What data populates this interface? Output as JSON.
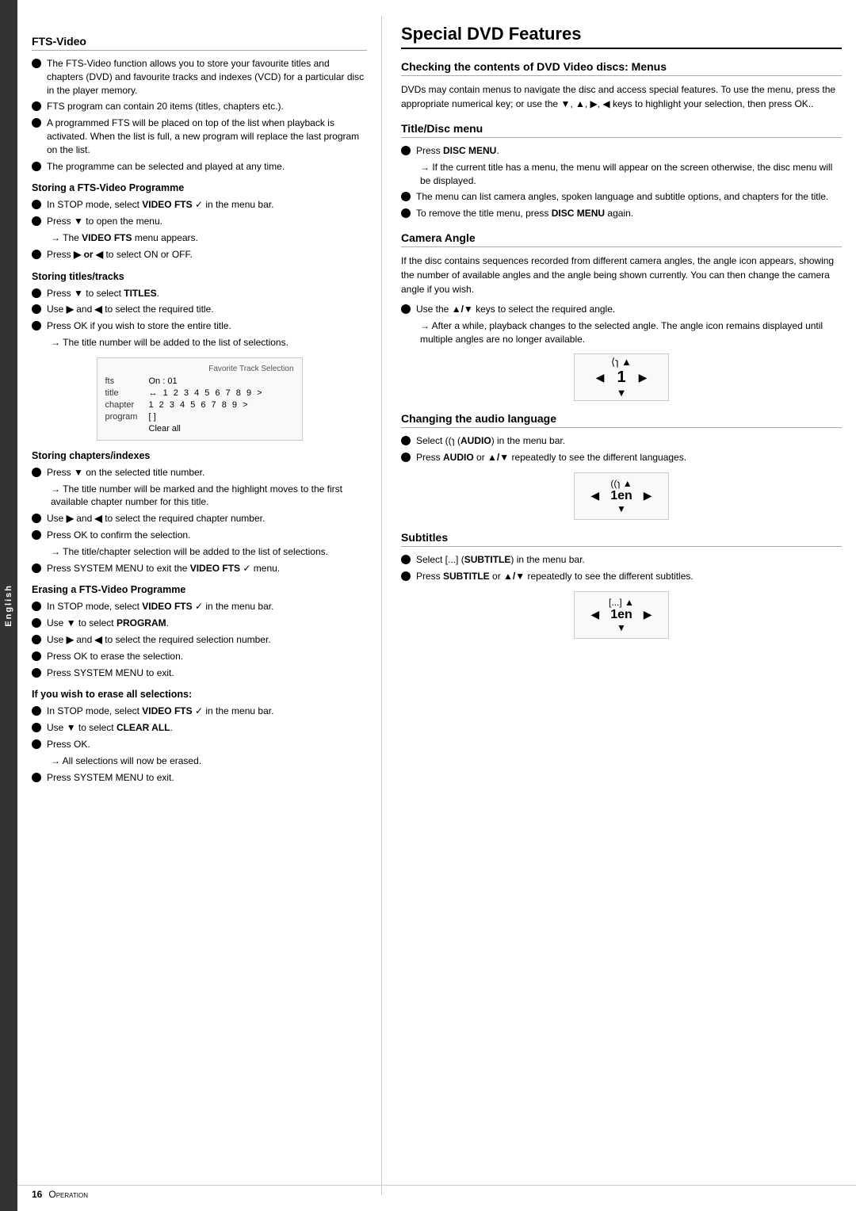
{
  "sidebar": {
    "label": "English"
  },
  "left": {
    "section_title": "FTS-Video",
    "intro_bullets": [
      "The FTS-Video function allows you to store your favourite titles and chapters (DVD) and favourite tracks and indexes (VCD) for a particular disc in the player memory.",
      "FTS program can contain 20 items (titles, chapters etc.).",
      "A programmed FTS will be placed on top of the list when playback is activated. When the list is full, a new program will replace the last program on the list.",
      "The programme can be selected and played at any time."
    ],
    "storing_programme": {
      "title": "Storing a FTS-Video Programme",
      "bullets": [
        {
          "text": "In STOP mode, select ",
          "bold": "VIDEO FTS",
          "after": " in the menu bar.",
          "icon": true
        },
        {
          "text": "Press ",
          "bold": "▼",
          "after": " to open the menu."
        },
        {
          "text": "→ The ",
          "bold": "VIDEO FTS",
          "after": " menu appears.",
          "arrow": true
        },
        {
          "text": "Press ",
          "bold": "▶ or ◀",
          "after": " to select ON or OFF."
        }
      ]
    },
    "storing_titles": {
      "title": "Storing titles/tracks",
      "bullets": [
        {
          "text": "Press ",
          "bold": "▼",
          "after": " to select ",
          "bold2": "TITLES",
          "end": "."
        },
        {
          "text": "Use ",
          "bold": "▶",
          "after": " and ",
          "bold2": "◀",
          "end": " to select the required title."
        },
        {
          "text": "Press OK if you wish to store the entire title."
        },
        {
          "text": "→ The title number will be added to the list of selections.",
          "arrow": true
        }
      ]
    },
    "fts_image": {
      "caption": "Favorite Track Selection",
      "fts_label": "fts",
      "on_value": "On : 01",
      "title_label": "title",
      "title_numbers": "1 2 3 4 5 6 7 8 9 >",
      "chapter_label": "chapter",
      "chapter_numbers": "1 2 3 4 5 6 7 8 9 >",
      "program_label": "program",
      "program_bracket": "[ ]",
      "clear_all": "Clear all"
    },
    "storing_chapters": {
      "title": "Storing chapters/indexes",
      "bullets": [
        {
          "text": "Press ",
          "bold": "▼",
          "after": " on the selected title number."
        },
        {
          "text": "→ The title number will be marked and the highlight moves to the first available chapter number for this title.",
          "arrow": true
        },
        {
          "text": "Use ",
          "bold": "▶",
          "after": " and ",
          "bold2": "◀",
          "end": " to select the required chapter number."
        },
        {
          "text": "Press OK to confirm the selection."
        },
        {
          "text": "→ The title/chapter selection will be added to the list of selections.",
          "arrow": true
        },
        {
          "text": "Press SYSTEM MENU to exit the ",
          "bold": "VIDEO FTS",
          "after": " menu.",
          "icon": true
        }
      ]
    },
    "erasing_programme": {
      "title": "Erasing a FTS-Video Programme",
      "bullets": [
        {
          "text": "In STOP mode, select ",
          "bold": "VIDEO FTS",
          "after": " in the menu bar.",
          "icon": true
        },
        {
          "text": "Use ",
          "bold": "▼",
          "after": " to select ",
          "bold2": "PROGRAM",
          "end": "."
        },
        {
          "text": "Use ",
          "bold": "▶",
          "after": " and ",
          "bold2": "◀",
          "end": " to select the required selection number."
        },
        {
          "text": "Press OK to erase the selection."
        },
        {
          "text": "Press SYSTEM MENU to exit."
        }
      ]
    },
    "erase_all": {
      "title": "If you wish to erase all selections:",
      "bullets": [
        {
          "text": "In STOP mode, select ",
          "bold": "VIDEO FTS",
          "after": " in the menu bar.",
          "icon": true
        },
        {
          "text": "Use ",
          "bold": "▼",
          "after": " to select ",
          "bold2": "CLEAR ALL",
          "end": "."
        },
        {
          "text": "Press OK."
        },
        {
          "text": "→ All selections will now be erased.",
          "arrow": true
        },
        {
          "text": "Press SYSTEM MENU to exit."
        }
      ]
    }
  },
  "right": {
    "main_title": "Special DVD Features",
    "checking_dvd": {
      "title": "Checking the contents of DVD Video discs: Menus",
      "body": "DVDs may contain menus to navigate the disc and access special features. To use the menu, press the appropriate numerical key; or use the ▼, ▲, ▶, ◀ keys to highlight your selection, then press OK.."
    },
    "title_disc_menu": {
      "title": "Title/Disc menu",
      "bullets": [
        {
          "text": "Press ",
          "bold": "DISC MENU",
          "after": "."
        },
        {
          "text": "→ If the current title has a menu, the menu will appear on the screen otherwise, the disc menu will be displayed.",
          "arrow": true
        },
        {
          "text": "The menu can list camera angles, spoken language and subtitle options, and chapters for the title."
        },
        {
          "text": "To remove the title menu, press ",
          "bold": "DISC MENU",
          "after": " again."
        }
      ]
    },
    "camera_angle": {
      "title": "Camera Angle",
      "body": "If the disc contains sequences recorded from different camera angles, the angle icon appears, showing the number of available angles and the angle being shown currently. You can then change the camera angle if you wish.",
      "bullets": [
        {
          "text": "Use the ",
          "bold": "▲/▼",
          "after": " keys to select the required angle."
        },
        {
          "text": "→ After a while, playback changes to the selected angle. The angle icon remains displayed until multiple angles are no longer available.",
          "arrow": true
        }
      ],
      "diagram": {
        "icon_top": "⟨ɿ",
        "icon_left": "◀",
        "icon_right": "▶",
        "number": "1",
        "icon_bottom": "▼"
      }
    },
    "audio_language": {
      "title": "Changing the audio language",
      "bullets": [
        {
          "text": "Select ",
          "bold_icon": "(AUDIO)",
          "after": " in the menu bar."
        },
        {
          "text": "Press ",
          "bold": "AUDIO",
          "after": " or ",
          "bold2": "▲/▼",
          "end": " repeatedly to see the different languages."
        }
      ],
      "diagram": {
        "icon_top": "▲",
        "icon_left": "◀",
        "icon_right": "▶",
        "lang": "1en",
        "icon_bottom": "▼"
      }
    },
    "subtitles": {
      "title": "Subtitles",
      "bullets": [
        {
          "text": "Select ",
          "bold_icon": "(SUBTITLE)",
          "after": " in the menu bar."
        },
        {
          "text": "Press ",
          "bold": "SUBTITLE",
          "after": " or ",
          "bold2": "▲/▼",
          "end": " repeatedly to see the different subtitles."
        }
      ],
      "diagram": {
        "icon_top": "▲",
        "icon_left": "◀",
        "icon_right": "▶",
        "lang": "1en",
        "icon_bottom": "▼"
      }
    }
  },
  "footer": {
    "page_number": "16",
    "label": "Operation"
  }
}
